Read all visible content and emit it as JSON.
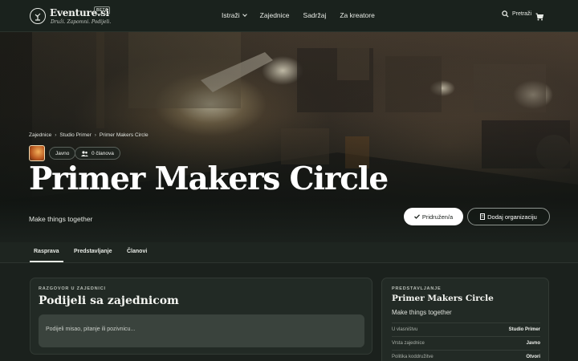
{
  "nav": {
    "brand": "Eventure.si",
    "beta": "BETA",
    "tagline": "Druži. Zapomni. Podijeli.",
    "links": [
      "Istraži",
      "Zajednice",
      "Sadržaj",
      "Za kreatore"
    ],
    "search_label": "Pretraži"
  },
  "hero": {
    "breadcrumbs": [
      "Zajednice",
      "Studio Primer",
      "Primer Makers Circle"
    ],
    "visibility": "Javno",
    "members": "0 članova",
    "title": "Primer Makers Circle",
    "subtitle": "Make things together",
    "join_label": "Pridružen/a",
    "add_org_label": "Dodaj organizaciju"
  },
  "tabs": [
    "Rasprava",
    "Predstavljanje",
    "Članovi"
  ],
  "discussion": {
    "eyebrow": "RAZGOVOR U ZAJEDNICI",
    "title": "Podijeli sa zajednicom",
    "placeholder": "Podijeli misao, pitanje ili pozivnicu..."
  },
  "about": {
    "eyebrow": "PREDSTAVLJANJE",
    "title": "Primer Makers Circle",
    "description": "Make things together",
    "rows": [
      {
        "key": "U vlasništvu",
        "value": "Studio Primer"
      },
      {
        "key": "Vrsta zajednice",
        "value": "Javno"
      },
      {
        "key": "Politika koddružitve",
        "value": "Otvori"
      }
    ]
  },
  "colors": {
    "background": "#1b211d",
    "card": "#222a25",
    "accent": "#ffffff"
  }
}
